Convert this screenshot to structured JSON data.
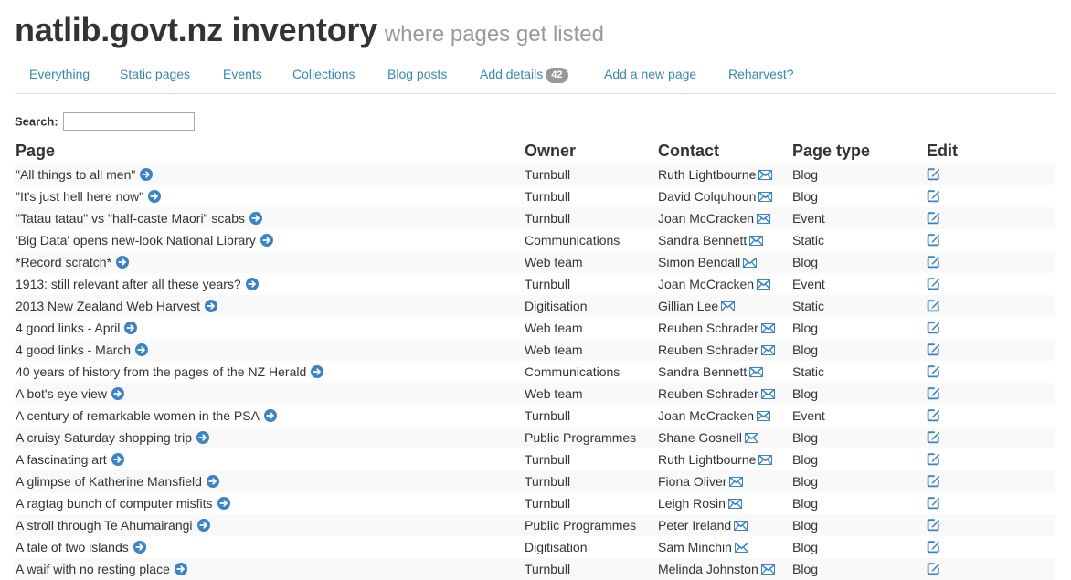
{
  "header": {
    "title": "natlib.govt.nz inventory",
    "subtitle": "where pages get listed"
  },
  "nav": {
    "items": [
      {
        "label": "Everything"
      },
      {
        "label": "Static pages"
      },
      {
        "label": "Events"
      },
      {
        "label": "Collections"
      },
      {
        "label": "Blog posts"
      },
      {
        "label": "Add details",
        "badge": "42"
      },
      {
        "label": "Add a new page"
      },
      {
        "label": "Reharvest?"
      }
    ]
  },
  "search": {
    "label": "Search:",
    "value": ""
  },
  "table": {
    "headers": {
      "page": "Page",
      "owner": "Owner",
      "contact": "Contact",
      "page_type": "Page type",
      "edit": "Edit"
    },
    "rows": [
      {
        "page": "\"All things to all men\"",
        "owner": "Turnbull",
        "contact": "Ruth Lightbourne",
        "type": "Blog"
      },
      {
        "page": "\"It's just hell here now\"",
        "owner": "Turnbull",
        "contact": "David Colquhoun",
        "type": "Blog"
      },
      {
        "page": "\"Tatau tatau\" vs \"half-caste Maori\" scabs",
        "owner": "Turnbull",
        "contact": "Joan McCracken",
        "type": "Event"
      },
      {
        "page": "'Big Data' opens new-look National Library",
        "owner": "Communications",
        "contact": "Sandra Bennett",
        "type": "Static"
      },
      {
        "page": "*Record scratch*",
        "owner": "Web team",
        "contact": "Simon Bendall",
        "type": "Blog"
      },
      {
        "page": "1913: still relevant after all these years?",
        "owner": "Turnbull",
        "contact": "Joan McCracken",
        "type": "Event"
      },
      {
        "page": "2013 New Zealand Web Harvest",
        "owner": "Digitisation",
        "contact": "Gillian Lee",
        "type": "Static"
      },
      {
        "page": "4 good links - April",
        "owner": "Web team",
        "contact": "Reuben Schrader",
        "type": "Blog"
      },
      {
        "page": "4 good links - March",
        "owner": "Web team",
        "contact": "Reuben Schrader",
        "type": "Blog"
      },
      {
        "page": "40 years of history from the pages of the NZ Herald",
        "owner": "Communications",
        "contact": "Sandra Bennett",
        "type": "Static"
      },
      {
        "page": "A bot's eye view",
        "owner": "Web team",
        "contact": "Reuben Schrader",
        "type": "Blog"
      },
      {
        "page": "A century of remarkable women in the PSA",
        "owner": "Turnbull",
        "contact": "Joan McCracken",
        "type": "Event"
      },
      {
        "page": "A cruisy Saturday shopping trip",
        "owner": "Public Programmes",
        "contact": "Shane Gosnell",
        "type": "Blog"
      },
      {
        "page": "A fascinating art",
        "owner": "Turnbull",
        "contact": "Ruth Lightbourne",
        "type": "Blog"
      },
      {
        "page": "A glimpse of Katherine Mansfield",
        "owner": "Turnbull",
        "contact": "Fiona Oliver",
        "type": "Blog"
      },
      {
        "page": "A ragtag bunch of computer misfits",
        "owner": "Turnbull",
        "contact": "Leigh Rosin",
        "type": "Blog"
      },
      {
        "page": "A stroll through Te Ahumairangi",
        "owner": "Public Programmes",
        "contact": "Peter Ireland",
        "type": "Blog"
      },
      {
        "page": "A tale of two islands",
        "owner": "Digitisation",
        "contact": "Sam Minchin",
        "type": "Blog"
      },
      {
        "page": "A waif with no resting place",
        "owner": "Turnbull",
        "contact": "Melinda Johnston",
        "type": "Blog"
      }
    ]
  },
  "icons": {
    "go": "arrow-right-circle-icon",
    "mail": "envelope-icon",
    "edit": "edit-square-icon"
  },
  "colors": {
    "link": "#3a87ad",
    "icon": "#3b83c4",
    "badge": "#999999",
    "stripe": "#f9f9f9"
  }
}
